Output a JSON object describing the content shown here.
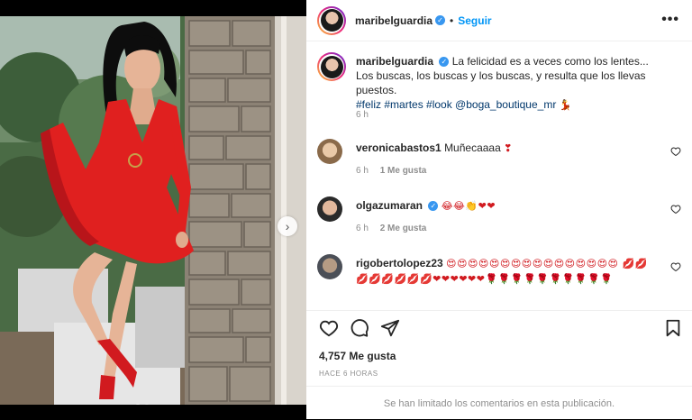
{
  "post": {
    "username": "maribelguardia",
    "follow_label": "Seguir",
    "more_icon": "•••",
    "caption": {
      "username": "maribelguardia",
      "text": "La felicidad es a veces como los lentes... Los buscas, los buscas y los buscas, y resulta que los llevas puestos.",
      "tags": "#feliz #martes #look @boga_boutique_mr",
      "emoji": "💃",
      "time": "6 h"
    },
    "comments": [
      {
        "username": "veronicabastos1",
        "verified": false,
        "text": "Muñecaaaa",
        "emoji": "❣",
        "time": "6 h",
        "likes": "1 Me gusta"
      },
      {
        "username": "olgazumaran",
        "verified": true,
        "text": "",
        "emoji": "😂😂👏❤❤",
        "time": "6 h",
        "likes": "2 Me gusta"
      },
      {
        "username": "rigobertolopez23",
        "verified": false,
        "text": "",
        "emoji": "😍😍😍😍😍😍😍😍😍😍😍😍😍😍😍😍 💋💋💋💋💋💋💋💋❤❤❤❤❤❤🌹🌹🌹🌹🌹🌹🌹🌹🌹🌹",
        "time": "",
        "likes": ""
      }
    ],
    "like_count": "4,757 Me gusta",
    "time_ago": "HACE 6 HORAS",
    "comments_limited": "Se han limitado los comentarios en esta publicación."
  },
  "colors": {
    "accent": "#0095f6",
    "verified": "#3897f0",
    "dress": "#e0201f"
  },
  "icons": [
    "like-icon",
    "comment-icon",
    "share-icon",
    "save-icon",
    "heart-icon",
    "next-arrow-icon",
    "more-icon"
  ]
}
